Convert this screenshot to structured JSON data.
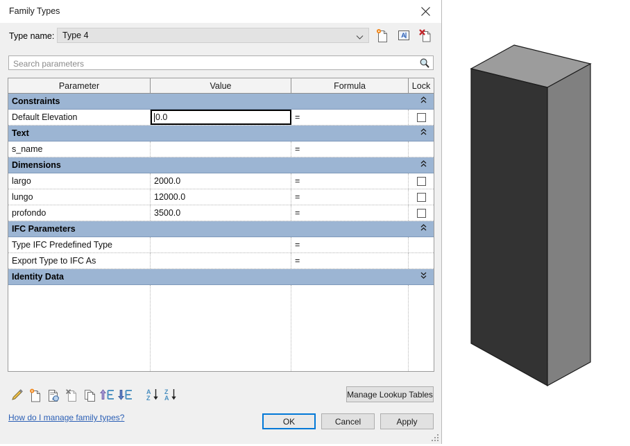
{
  "window": {
    "title": "Family Types",
    "close_icon": "close-icon"
  },
  "type_name": {
    "label": "Type name:",
    "value": "Type 4",
    "dropdown_icon": "chevron-down-icon",
    "actions": [
      {
        "name": "new-type-icon",
        "tooltip": "New Type"
      },
      {
        "name": "rename-type-icon",
        "tooltip": "Rename"
      },
      {
        "name": "delete-type-icon",
        "tooltip": "Delete"
      }
    ]
  },
  "search": {
    "placeholder": "Search parameters",
    "value": "",
    "icon": "search-icon"
  },
  "table": {
    "columns": [
      "Parameter",
      "Value",
      "Formula",
      "Lock"
    ],
    "groups": [
      {
        "name": "Constraints",
        "collapsed": false,
        "chevron": "«",
        "rows": [
          {
            "parameter": "Default Elevation",
            "value": "0.0",
            "formula": "=",
            "lock": true,
            "active": true
          }
        ]
      },
      {
        "name": "Text",
        "collapsed": false,
        "chevron": "«",
        "rows": [
          {
            "parameter": "s_name",
            "value": "",
            "formula": "=",
            "lock": false,
            "active": false
          }
        ]
      },
      {
        "name": "Dimensions",
        "collapsed": false,
        "chevron": "«",
        "rows": [
          {
            "parameter": "largo",
            "value": "2000.0",
            "formula": "=",
            "lock": true,
            "active": false
          },
          {
            "parameter": "lungo",
            "value": "12000.0",
            "formula": "=",
            "lock": true,
            "active": false
          },
          {
            "parameter": "profondo",
            "value": "3500.0",
            "formula": "=",
            "lock": true,
            "active": false
          }
        ]
      },
      {
        "name": "IFC Parameters",
        "collapsed": false,
        "chevron": "«",
        "rows": [
          {
            "parameter": "Type IFC Predefined Type",
            "value": "",
            "formula": "=",
            "lock": false,
            "active": false
          },
          {
            "parameter": "Export Type to IFC As",
            "value": "",
            "formula": "=",
            "lock": false,
            "active": false
          }
        ]
      },
      {
        "name": "Identity Data",
        "collapsed": true,
        "chevron": "»",
        "rows": []
      }
    ]
  },
  "toolbar": {
    "items": [
      {
        "name": "edit-parameter-icon",
        "label": "Edit Parameter"
      },
      {
        "name": "new-parameter-icon",
        "label": "New Parameter"
      },
      {
        "name": "remove-parameter-icon",
        "label": "Remove Parameter"
      },
      {
        "name": "add-parameter-to-group-icon",
        "label": "Add Parameter"
      },
      {
        "name": "duplicate-parameter-icon",
        "label": "Duplicate"
      },
      {
        "name": "move-parameter-up-icon",
        "label": "Move Up"
      },
      {
        "name": "move-parameter-down-icon",
        "label": "Move Down"
      },
      {
        "name": "sort-ascending-icon",
        "label": "Sort Ascending"
      },
      {
        "name": "sort-descending-icon",
        "label": "Sort Descending"
      }
    ]
  },
  "links": {
    "help": "How do I manage family types?"
  },
  "buttons": {
    "lookup": "Manage Lookup Tables",
    "ok": "OK",
    "cancel": "Cancel",
    "apply": "Apply"
  },
  "viewport": {
    "shape": "extruded-box",
    "colors": {
      "front_face": "#333333",
      "side_face": "#808080",
      "top_face": "#9c9c9c",
      "outline": "#1a1a1a",
      "background": "#ffffff"
    }
  },
  "colors": {
    "group_band": "#9cb5d3",
    "dialog_bg": "#f0f0f0",
    "accent_focus": "#0078d7",
    "link": "#2b5fb5"
  }
}
